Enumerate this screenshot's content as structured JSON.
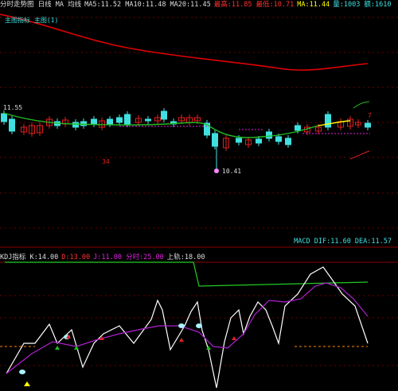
{
  "colors": {
    "background": "#000000",
    "divider": "#8b0000",
    "grid": "#6b0000",
    "ma_long": "#e00000",
    "ma_short": "#22bb22",
    "up_candle": "#e02020",
    "down_candle": "#40e0e0",
    "accent_magenta": "#dd22dd",
    "indicator_white": "#ffffff",
    "indicator_purple": "#b020d0",
    "indicator_green": "#22cc22",
    "orange_dash": "#ff8800",
    "yellow": "#ffff00"
  },
  "header": {
    "segments": [
      {
        "name": "title-segment",
        "text": "分时走势图 日线 MA 均线",
        "color": "#dddddd"
      },
      {
        "name": "values-segment",
        "text": "MA5:11.52 MA10:11.48 MA20:11.45",
        "color": "#dddddd"
      },
      {
        "name": "high-segment",
        "text": "最高:11.85 最低:10.71",
        "color": "#ff3030"
      },
      {
        "name": "ma-segment",
        "text": "MA:11.44",
        "color": "#ffff00"
      },
      {
        "name": "tail-segment",
        "text": "量:1003 额:1610",
        "color": "#40e0e0"
      }
    ],
    "second_line": "主图指标  主图(1)"
  },
  "main_panel": {
    "left_price_label": "11.55",
    "low_price_label": "10.41",
    "marker_value": "34",
    "right_indicator_label": "7"
  },
  "mid_bar": {
    "left": "",
    "right": "MACD  DIF:11.60  DEA:11.57"
  },
  "lower_panel": {
    "segments": [
      {
        "name": "lower-title",
        "text": "KDJ指标 K:14.00",
        "color": "#dddddd"
      },
      {
        "name": "lower-d",
        "text": "D:13.00",
        "color": "#ff3030"
      },
      {
        "name": "lower-j",
        "text": "J:11.00 分时:25.00",
        "color": "#dd22dd"
      },
      {
        "name": "lower-line",
        "text": "上轨:18.00",
        "color": "#dddddd"
      }
    ],
    "arrow_labels": [
      "8",
      "8",
      "8"
    ]
  }
}
